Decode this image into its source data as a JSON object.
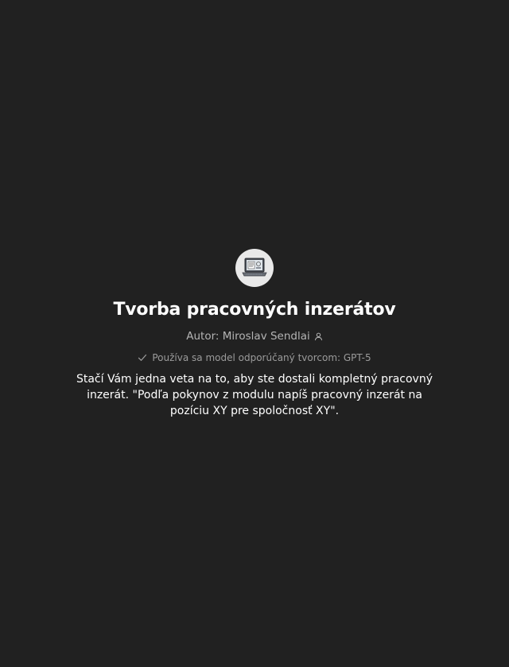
{
  "gpt": {
    "title": "Tvorba pracovných inzerátov",
    "author_label": "Autor: Miroslav Sendlai",
    "model_note": "Používa sa model odporúčaný tvorcom: GPT-5",
    "description": "Stačí Vám jedna veta na to, aby ste dostali kompletný pracovný inzerát. \"Podľa pokynov z modulu napíš pracovný inzerát na pozíciu XY pre spoločnosť XY\"."
  },
  "icons": {
    "avatar": "laptop-icon",
    "author": "person-icon",
    "model": "checkmark-icon"
  },
  "colors": {
    "background": "#212121",
    "title": "#ffffff",
    "author": "#b4b4b4",
    "model": "#9b9b9b",
    "avatar_bg": "#e9e9e9"
  }
}
